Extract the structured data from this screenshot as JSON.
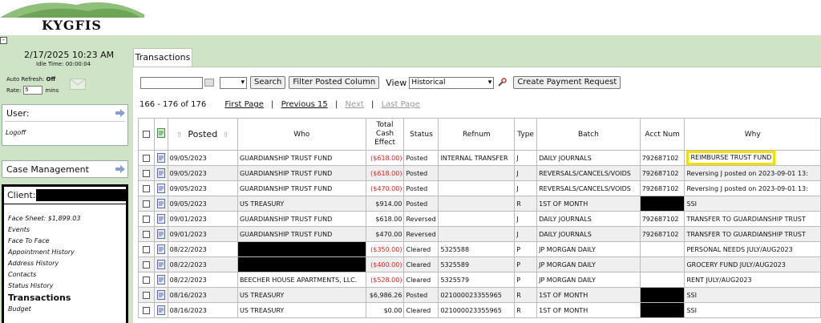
{
  "app": {
    "logo_text": "KYGFIS"
  },
  "sidebar": {
    "collapse_label": "-",
    "date_time": "2/17/2025 10:23 AM",
    "idle_time": "Idle Time: 00:00:04",
    "auto_refresh_label": "Auto Refresh:",
    "auto_refresh_value": "Off",
    "rate_label": "Rate:",
    "rate_value": "5",
    "rate_unit": "mins",
    "user_title": "User:",
    "logoff": "Logoff",
    "case_management": "Case Management",
    "client_label": "Client:",
    "client_links": [
      "Face Sheet: $1,899.03",
      "Events",
      "Face To Face",
      "Appointment History",
      "Address History",
      "Contacts",
      "Status History",
      "Transactions",
      "Budget"
    ]
  },
  "tabs": {
    "active": "Transactions"
  },
  "toolbar": {
    "search_value": "",
    "filter_value": "",
    "search_button": "Search",
    "filter_posted_button": "Filter Posted Column",
    "view_label": "View",
    "view_value": "Historical",
    "create_payment_button": "Create Payment Request"
  },
  "pager": {
    "range": "166 - 176 of 176",
    "first": "First Page",
    "previous": "Previous 15",
    "next": "Next",
    "last": "Last Page"
  },
  "table": {
    "headers": {
      "posted": "Posted",
      "who": "Who",
      "total_cash_effect": "Total Cash Effect",
      "status": "Status",
      "refnum": "Refnum",
      "type": "Type",
      "batch": "Batch",
      "acct_num": "Acct Num",
      "why": "Why"
    },
    "rows": [
      {
        "posted": "09/05/2023",
        "who": "GUARDIANSHIP TRUST FUND",
        "amount": "($618.00)",
        "status": "Posted",
        "refnum": "INTERNAL TRANSFER",
        "type": "J",
        "batch": "DAILY JOURNALS",
        "acct": "792687102",
        "why": "REIMBURSE TRUST FUND"
      },
      {
        "posted": "09/05/2023",
        "who": "GUARDIANSHIP TRUST FUND",
        "amount": "($618.00)",
        "status": "Posted",
        "refnum": "",
        "type": "J",
        "batch": "REVERSALS/CANCELS/VOIDS",
        "acct": "792687102",
        "why": "Reversing J posted on 2023-09-01 13:"
      },
      {
        "posted": "09/05/2023",
        "who": "GUARDIANSHIP TRUST FUND",
        "amount": "($470.00)",
        "status": "Posted",
        "refnum": "",
        "type": "J",
        "batch": "REVERSALS/CANCELS/VOIDS",
        "acct": "792687102",
        "why": "Reversing J posted on 2023-09-01 13:"
      },
      {
        "posted": "09/05/2023",
        "who": "US TREASURY",
        "amount": "$914.00",
        "status": "Posted",
        "refnum": "",
        "type": "R",
        "batch": "1ST OF MONTH",
        "acct": "",
        "why": "SSI"
      },
      {
        "posted": "09/01/2023",
        "who": "GUARDIANSHIP TRUST FUND",
        "amount": "$618.00",
        "status": "Reversed",
        "refnum": "",
        "type": "J",
        "batch": "DAILY JOURNALS",
        "acct": "792687102",
        "why": "TRANSFER TO GUARDIANSHIP TRUST"
      },
      {
        "posted": "09/01/2023",
        "who": "GUARDIANSHIP TRUST FUND",
        "amount": "$470.00",
        "status": "Reversed",
        "refnum": "",
        "type": "J",
        "batch": "DAILY JOURNALS",
        "acct": "792687102",
        "why": "TRANSFER TO GUARDIANSHIP TRUST"
      },
      {
        "posted": "08/22/2023",
        "who": "",
        "amount": "($350.00)",
        "status": "Cleared",
        "refnum": "5325588",
        "type": "P",
        "batch": "JP MORGAN DAILY",
        "acct": "",
        "why": "PERSONAL NEEDS JULY/AUG2023"
      },
      {
        "posted": "08/22/2023",
        "who": "",
        "amount": "($400.00)",
        "status": "Cleared",
        "refnum": "5325589",
        "type": "P",
        "batch": "JP MORGAN DAILY",
        "acct": "",
        "why": "GROCERY FUND JULY/AUG2023"
      },
      {
        "posted": "08/22/2023",
        "who": "BEECHER HOUSE APARTMENTS, LLC.",
        "amount": "($528.00)",
        "status": "Cleared",
        "refnum": "5325579",
        "type": "P",
        "batch": "JP MORGAN DAILY",
        "acct": "",
        "why": "RENT JULY/AUG2023"
      },
      {
        "posted": "08/16/2023",
        "who": "US TREASURY",
        "amount": "$6,986.26",
        "status": "Posted",
        "refnum": "021000023355965",
        "type": "R",
        "batch": "1ST OF MONTH",
        "acct": "",
        "why": "SSI"
      },
      {
        "posted": "08/16/2023",
        "who": "US TREASURY",
        "amount": "$0.00",
        "status": "Cleared",
        "refnum": "021000023355965",
        "type": "R",
        "batch": "1ST OF MONTH",
        "acct": "",
        "why": "SSI"
      }
    ]
  }
}
